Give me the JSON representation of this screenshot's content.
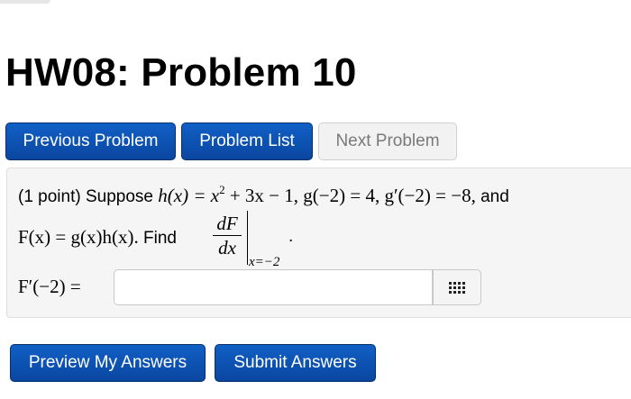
{
  "page": {
    "title": "HW08: Problem 10"
  },
  "nav": {
    "previous_label": "Previous Problem",
    "list_label": "Problem List",
    "next_label": "Next Problem"
  },
  "problem": {
    "points": "(1 point) Suppose",
    "h_def": "h(x) = x",
    "h_exp": "2",
    "h_rest": " + 3x − 1, g(−2) = 4, g′(−2) = −8,",
    "and": "and",
    "F_def": "F(x) = g(x)h(x).",
    "find": "Find",
    "frac_num": "dF",
    "frac_den": "dx",
    "eval_at": "x=−2",
    "period": ".",
    "answer_label": "F′(−2) =",
    "answer_value": "",
    "answer_tool_icon": "grid-icon"
  },
  "actions": {
    "preview_label": "Preview My Answers",
    "submit_label": "Submit Answers"
  }
}
